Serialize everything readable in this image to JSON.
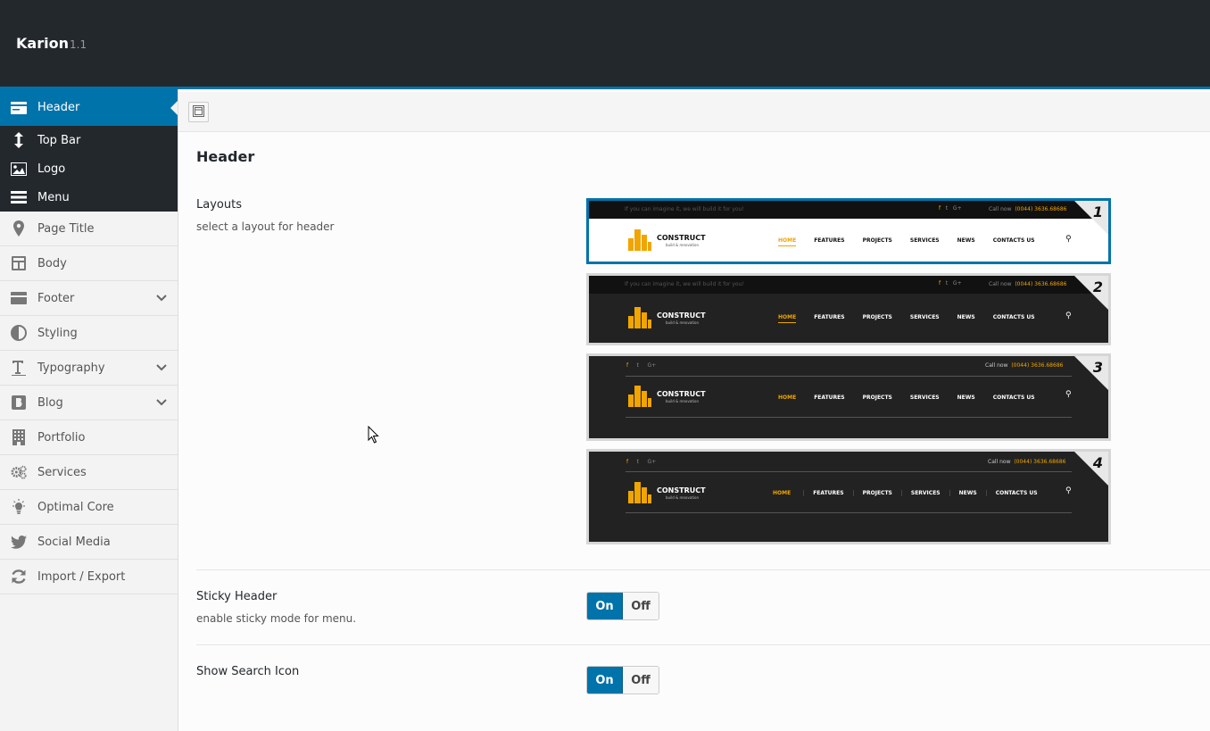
{
  "app": {
    "name": "Karion",
    "version": "1.1"
  },
  "sidebar": {
    "items": [
      {
        "label": "Header",
        "icon": "card-icon",
        "active": true
      },
      {
        "label": "Top Bar",
        "icon": "arrows-vertical-icon",
        "sub": true
      },
      {
        "label": "Logo",
        "icon": "image-icon",
        "sub": true
      },
      {
        "label": "Menu",
        "icon": "hamburger-icon",
        "sub": true
      },
      {
        "label": "Page Title",
        "icon": "map-pin-icon"
      },
      {
        "label": "Body",
        "icon": "layout-icon"
      },
      {
        "label": "Footer",
        "icon": "footer-icon",
        "chevron": true
      },
      {
        "label": "Styling",
        "icon": "half-circle-icon"
      },
      {
        "label": "Typography",
        "icon": "text-icon",
        "chevron": true
      },
      {
        "label": "Blog",
        "icon": "blog-icon",
        "chevron": true
      },
      {
        "label": "Portfolio",
        "icon": "building-icon"
      },
      {
        "label": "Services",
        "icon": "gears-icon"
      },
      {
        "label": "Optimal Core",
        "icon": "lightbulb-icon"
      },
      {
        "label": "Social Media",
        "icon": "twitter-icon"
      },
      {
        "label": "Import / Export",
        "icon": "refresh-icon"
      }
    ]
  },
  "main": {
    "section_title": "Header",
    "layouts": {
      "title": "Layouts",
      "desc": "select a layout for header",
      "selected": 1,
      "options": [
        {
          "number": "1"
        },
        {
          "number": "2"
        },
        {
          "number": "3"
        },
        {
          "number": "4"
        }
      ],
      "preview": {
        "tagline": "If you can imagine it, we will build it for you!",
        "call_label": "Call now",
        "phone": "(0044) 3636.68686",
        "logo_name": "CONSTRUCT",
        "logo_sub": "build & renovation",
        "menu": [
          "HOME",
          "FEATURES",
          "PROJECTS",
          "SERVICES",
          "NEWS",
          "CONTACTS US"
        ]
      }
    },
    "sticky": {
      "title": "Sticky Header",
      "desc": "enable sticky mode for menu.",
      "on": "On",
      "off": "Off",
      "value": "On"
    },
    "search": {
      "title": "Show Search Icon",
      "on": "On",
      "off": "Off",
      "value": "On"
    }
  },
  "colors": {
    "accent": "#0073aa",
    "dark": "#23282d",
    "brand_yellow": "#f0a500"
  }
}
